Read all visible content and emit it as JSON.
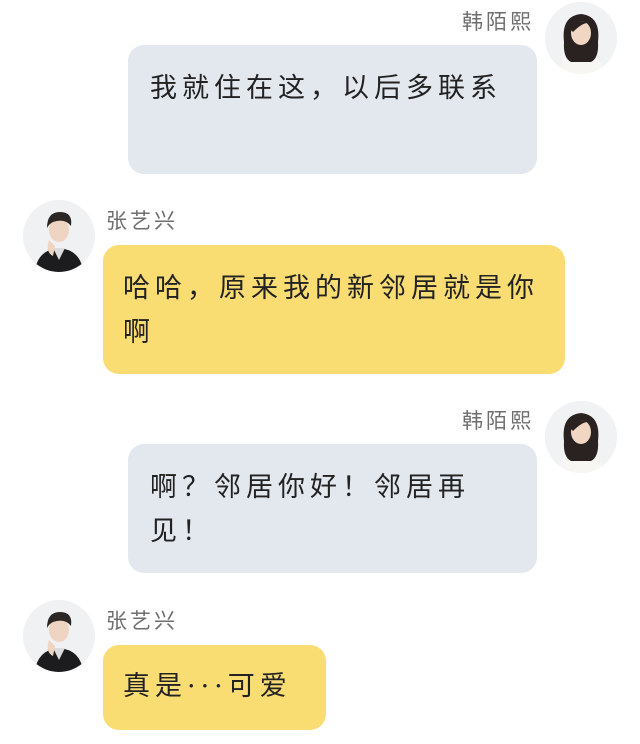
{
  "colors": {
    "self_bubble": "#e3e7ee",
    "other_bubble": "#fadd72",
    "name_text": "#6e6e6e",
    "message_text": "#222222",
    "background": "#ffffff"
  },
  "participants": {
    "self": {
      "name": "韩陌熙",
      "avatar_icon": "avatar-girl-icon"
    },
    "other": {
      "name": "张艺兴",
      "avatar_icon": "avatar-boy-icon"
    }
  },
  "messages": [
    {
      "sender": "韩陌熙",
      "side": "right",
      "text": "我就住在这，以后多联系"
    },
    {
      "sender": "张艺兴",
      "side": "left",
      "text": "哈哈，原来我的新邻居就是你啊"
    },
    {
      "sender": "韩陌熙",
      "side": "right",
      "text": "啊？邻居你好！邻居再见！"
    },
    {
      "sender": "张艺兴",
      "side": "left",
      "text": "真是···可爱"
    }
  ]
}
